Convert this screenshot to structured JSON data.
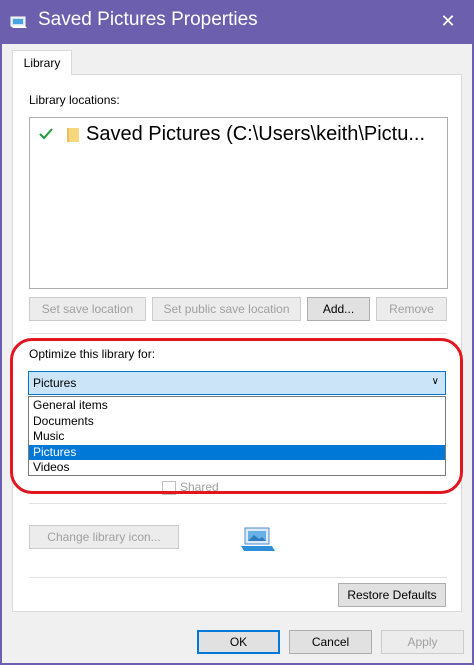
{
  "window": {
    "title": "Saved Pictures Properties",
    "close_glyph": "✕",
    "title_icon": "library-properties-icon"
  },
  "tab": {
    "label": "Library"
  },
  "locations": {
    "label": "Library locations:",
    "items": [
      {
        "text": "Saved Pictures (C:\\Users\\keith\\Pictu...",
        "checked": true,
        "icon": "folder-icon"
      }
    ]
  },
  "location_buttons": {
    "set_save": "Set save location",
    "set_public_save": "Set public save location",
    "add": "Add...",
    "remove": "Remove"
  },
  "optimize": {
    "label": "Optimize this library for:",
    "selected": "Pictures",
    "options": [
      "General items",
      "Documents",
      "Music",
      "Pictures",
      "Videos"
    ],
    "selected_index": 3
  },
  "attributes": {
    "shared_label": "Shared"
  },
  "icon_section": {
    "change_icon": "Change library icon...",
    "icon": "pictures-library-icon"
  },
  "restore": {
    "label": "Restore Defaults"
  },
  "dialog_buttons": {
    "ok": "OK",
    "cancel": "Cancel",
    "apply": "Apply"
  },
  "colors": {
    "titlebar": "#6b5fae",
    "accent": "#0078d7",
    "highlight_oval": "#e2161f"
  }
}
